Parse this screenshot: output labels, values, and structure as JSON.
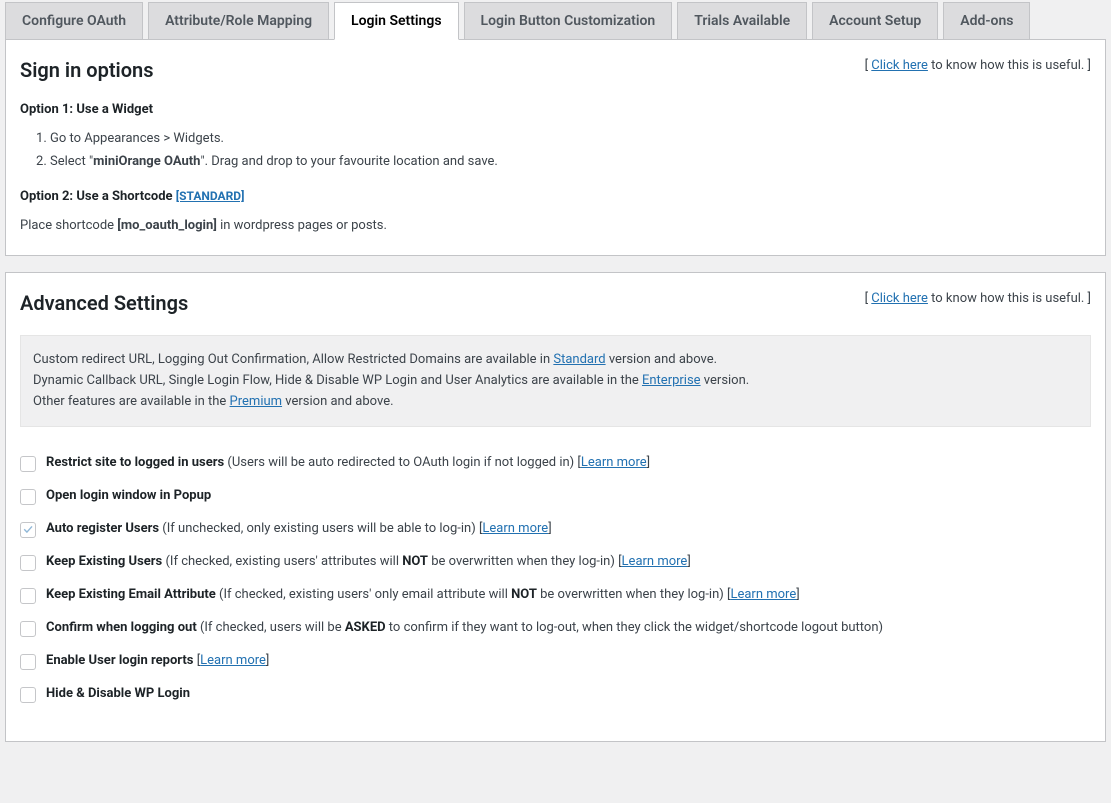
{
  "tabs": [
    {
      "label": "Configure OAuth",
      "active": false
    },
    {
      "label": "Attribute/Role Mapping",
      "active": false
    },
    {
      "label": "Login Settings",
      "active": true
    },
    {
      "label": "Login Button Customization",
      "active": false
    },
    {
      "label": "Trials Available",
      "active": false
    },
    {
      "label": "Account Setup",
      "active": false
    },
    {
      "label": "Add-ons",
      "active": false
    }
  ],
  "signin": {
    "title": "Sign in options",
    "hint_prefix": "[ ",
    "hint_link": "Click here",
    "hint_suffix": " to know how this is useful. ]",
    "option1_title": "Option 1: Use a Widget",
    "steps": [
      "Go to Appearances > Widgets.",
      "Select \"miniOrange OAuth\". Drag and drop to your favourite location and save."
    ],
    "option2_title": "Option 2: Use a Shortcode",
    "option2_tag": "[STANDARD]",
    "shortcode_prefix": "Place shortcode ",
    "shortcode_code": "[mo_oauth_login]",
    "shortcode_suffix": " in wordpress pages or posts."
  },
  "advanced": {
    "title": "Advanced Settings",
    "hint_prefix": "[ ",
    "hint_link": "Click here",
    "hint_suffix": " to know how this is useful. ]",
    "info_line1a": "Custom redirect URL, Logging Out Confirmation, Allow Restricted Domains are available in ",
    "info_line1_link": "Standard",
    "info_line1b": " version and above.",
    "info_line2a": "Dynamic Callback URL, Single Login Flow, Hide & Disable WP Login and User Analytics are available in the ",
    "info_line2_link": "Enterprise",
    "info_line2b": " version.",
    "info_line3a": "Other features are available in the ",
    "info_line3_link": "Premium",
    "info_line3b": " version and above.",
    "learn_more": "Learn more",
    "items": [
      {
        "checked": false,
        "label": "Restrict site to logged in users",
        "hint": " (Users will be auto redirected to OAuth login if not logged in) ",
        "learn": true
      },
      {
        "checked": false,
        "label": "Open login window in Popup",
        "hint": "",
        "learn": false
      },
      {
        "checked": true,
        "label": "Auto register Users",
        "hint": " (If unchecked, only existing users will be able to log-in) ",
        "learn": true
      },
      {
        "checked": false,
        "label": "Keep Existing Users",
        "hint_pre": " (If checked, existing users' attributes will ",
        "hint_bold": "NOT",
        "hint_post": " be overwritten when they log-in) ",
        "learn": true
      },
      {
        "checked": false,
        "label": "Keep Existing Email Attribute",
        "hint_pre": " (If checked, existing users' only email attribute will ",
        "hint_bold": "NOT",
        "hint_post": " be overwritten when they log-in) ",
        "learn": true
      },
      {
        "checked": false,
        "label": "Confirm when logging out",
        "hint_pre": " (If checked, users will be ",
        "hint_bold": "ASKED",
        "hint_post": " to confirm if they want to log-out, when they click the widget/shortcode logout button)",
        "learn": false
      },
      {
        "checked": false,
        "label": "Enable User login reports",
        "hint": " ",
        "learn": true
      },
      {
        "checked": false,
        "label": "Hide & Disable WP Login",
        "hint": "",
        "learn": false
      }
    ]
  }
}
